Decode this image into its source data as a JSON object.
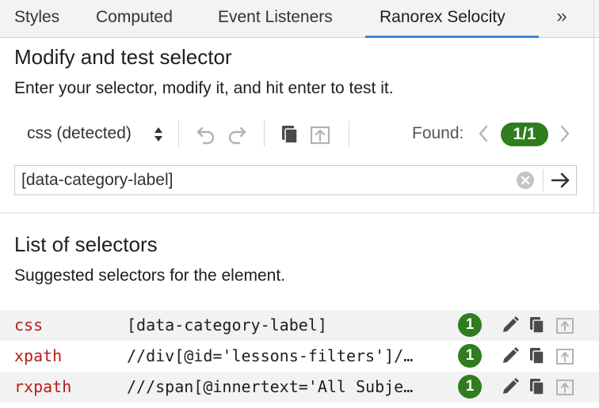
{
  "tabs": [
    {
      "label": "Styles"
    },
    {
      "label": "Computed"
    },
    {
      "label": "Event Listeners"
    },
    {
      "label": "Ranorex Selocity"
    }
  ],
  "tabs_more": "»",
  "modify": {
    "title": "Modify and test selector",
    "subtitle": "Enter your selector, modify it, and hit enter to test it.",
    "selector_type": "css (detected)",
    "found_label": "Found:",
    "found_count": "1/1",
    "input_value": "[data-category-label]"
  },
  "list": {
    "title": "List of selectors",
    "subtitle": "Suggested selectors for the element.",
    "rows": [
      {
        "type": "css",
        "selector": "[data-category-label]",
        "count": "1"
      },
      {
        "type": "xpath",
        "selector": "//div[@id='lessons-filters']/…",
        "count": "1"
      },
      {
        "type": "rxpath",
        "selector": "///span[@innertext='All Subje…",
        "count": "1"
      }
    ]
  },
  "colors": {
    "accent": "#3d85e0",
    "success": "#2f7d1e",
    "selector_type": "#b51d16"
  },
  "icons": {
    "undo": "undo-icon",
    "redo": "redo-icon",
    "copy": "copy-icon",
    "export": "export-icon",
    "edit": "pencil-icon"
  }
}
